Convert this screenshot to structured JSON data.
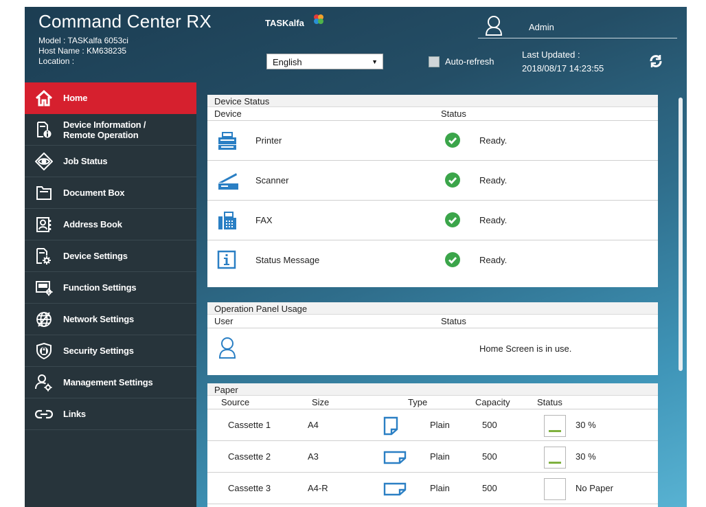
{
  "header": {
    "title": "Command Center RX",
    "model": "Model : TASKalfa 6053ci",
    "host": "Host Name : KM638235",
    "location": "Location :",
    "brand": "TASKalfa",
    "language": "English",
    "auto_refresh_label": "Auto-refresh",
    "user": "Admin",
    "last_updated_label": "Last Updated :",
    "last_updated_value": "2018/08/17 14:23:55"
  },
  "sidebar": {
    "items": [
      {
        "label": "Home",
        "icon": "home-icon",
        "active": true
      },
      {
        "label": "Device Information /\nRemote Operation",
        "icon": "device-info-icon"
      },
      {
        "label": "Job Status",
        "icon": "eye-icon"
      },
      {
        "label": "Document Box",
        "icon": "folder-icon"
      },
      {
        "label": "Address Book",
        "icon": "address-book-icon"
      },
      {
        "label": "Device Settings",
        "icon": "device-settings-icon"
      },
      {
        "label": "Function Settings",
        "icon": "function-settings-icon"
      },
      {
        "label": "Network Settings",
        "icon": "globe-icon"
      },
      {
        "label": "Security Settings",
        "icon": "shield-icon"
      },
      {
        "label": "Management Settings",
        "icon": "management-icon"
      },
      {
        "label": "Links",
        "icon": "link-icon"
      }
    ]
  },
  "device_status": {
    "title": "Device Status",
    "col_device": "Device",
    "col_status": "Status",
    "rows": [
      {
        "device": "Printer",
        "status": "Ready.",
        "icon": "printer-icon"
      },
      {
        "device": "Scanner",
        "status": "Ready.",
        "icon": "scanner-icon"
      },
      {
        "device": "FAX",
        "status": "Ready.",
        "icon": "fax-icon"
      },
      {
        "device": "Status Message",
        "status": "Ready.",
        "icon": "info-icon"
      }
    ]
  },
  "operation_panel": {
    "title": "Operation Panel Usage",
    "col_user": "User",
    "col_status": "Status",
    "status": "Home Screen is in use."
  },
  "paper": {
    "title": "Paper",
    "col_source": "Source",
    "col_size": "Size",
    "col_type": "Type",
    "col_capacity": "Capacity",
    "col_status": "Status",
    "rows": [
      {
        "source": "Cassette 1",
        "size": "A4",
        "type": "Plain",
        "capacity": "500",
        "status": "30 %",
        "level_percent": 30,
        "orientation": "portrait"
      },
      {
        "source": "Cassette 2",
        "size": "A3",
        "type": "Plain",
        "capacity": "500",
        "status": "30 %",
        "level_percent": 30,
        "orientation": "landscape"
      },
      {
        "source": "Cassette 3",
        "size": "A4-R",
        "type": "Plain",
        "capacity": "500",
        "status": "No Paper",
        "level_percent": 0,
        "orientation": "landscape"
      }
    ]
  },
  "colors": {
    "active_nav": "#d6202e",
    "sidebar_bg": "#27343b",
    "icon_blue": "#2a7fc4",
    "check_green": "#3ba54a",
    "gauge_green": "#7fb13f"
  }
}
